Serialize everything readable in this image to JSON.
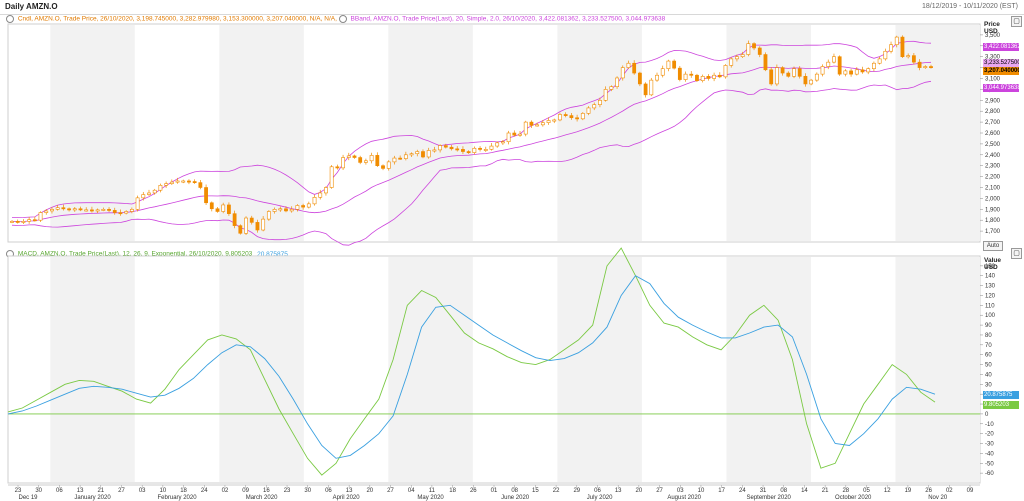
{
  "window": {
    "title": "Daily AMZN.O",
    "date_range": "18/12/2019 - 10/11/2020 (EST)"
  },
  "price_panel": {
    "legend_candle": "Cndl, AMZN.O, Trade Price, 26/10/2020, 3,198.745000, 3,282.979980, 3,153.300000, 3,207.040000, N/A, N/A,",
    "legend_bband": "BBand, AMZN.O, Trade Price(Last), 20, Simple, 2.0, 26/10/2020, 3,422.081362, 3,233.527500, 3,044.973638",
    "axis_title_1": "Price",
    "axis_title_2": "USD",
    "tag_upper": "3,422.081362",
    "tag_mid": "3,233.527500",
    "tag_close": "3,207.040000",
    "tag_lower": "3,044.973638",
    "auto": "Auto",
    "colors": {
      "candle": "#f08c00",
      "band": "#cc44dd",
      "tag_upper": "#cc44dd",
      "tag_close": "#f08c00"
    }
  },
  "macd_panel": {
    "legend": "MACD, AMZN.O, Trade Price(Last), 12, 26, 9, Exponential, 26/10/2020, 9.805203",
    "legend_signal": "20.875875",
    "axis_title_1": "Value",
    "axis_title_2": "USD",
    "tag_signal": "20.875875",
    "tag_macd": "9.805203",
    "colors": {
      "macd": "#7ac943",
      "signal": "#3aa0e0",
      "zero": "#7ac943"
    }
  },
  "x_axis": {
    "days": [
      "23",
      "30",
      "06",
      "13",
      "21",
      "27",
      "03",
      "10",
      "18",
      "24",
      "02",
      "09",
      "16",
      "23",
      "30",
      "06",
      "13",
      "20",
      "27",
      "04",
      "11",
      "18",
      "26",
      "01",
      "08",
      "15",
      "22",
      "29",
      "06",
      "13",
      "20",
      "27",
      "03",
      "10",
      "17",
      "24",
      "31",
      "08",
      "14",
      "21",
      "28",
      "05",
      "12",
      "19",
      "26",
      "02",
      "09"
    ],
    "months": [
      "Dec 19",
      "January 2020",
      "February 2020",
      "March 2020",
      "April 2020",
      "May 2020",
      "June 2020",
      "July 2020",
      "August 2020",
      "September 2020",
      "October 2020",
      "Nov 20"
    ]
  },
  "chart_data": [
    {
      "type": "candlestick",
      "title": "Daily AMZN.O",
      "ylabel": "Price USD",
      "ylim": [
        1600,
        3600
      ],
      "yticks": [
        1700,
        1800,
        1900,
        2000,
        2100,
        2200,
        2300,
        2400,
        2500,
        2600,
        2700,
        2800,
        2900,
        3000,
        3100,
        3200,
        3300,
        3400,
        3500
      ],
      "series": [
        {
          "name": "Cndl AMZN.O Trade Price",
          "values": [
            1790,
            1785,
            1790,
            1805,
            1800,
            1870,
            1885,
            1900,
            1915,
            1905,
            1900,
            1905,
            1895,
            1895,
            1890,
            1895,
            1900,
            1890,
            1870,
            1865,
            1880,
            1900,
            2005,
            2035,
            2050,
            2075,
            2120,
            2135,
            2150,
            2160,
            2160,
            2155,
            2145,
            2100,
            1960,
            1905,
            1880,
            1940,
            1860,
            1750,
            1680,
            1820,
            1780,
            1710,
            1810,
            1880,
            1900,
            1905,
            1885,
            1900,
            1935,
            1920,
            1950,
            2010,
            2050,
            2100,
            2290,
            2280,
            2375,
            2390,
            2375,
            2330,
            2345,
            2395,
            2300,
            2275,
            2335,
            2370,
            2365,
            2400,
            2410,
            2430,
            2380,
            2440,
            2445,
            2485,
            2470,
            2455,
            2450,
            2430,
            2420,
            2460,
            2450,
            2450,
            2480,
            2510,
            2520,
            2600,
            2580,
            2590,
            2700,
            2670,
            2675,
            2695,
            2715,
            2720,
            2770,
            2760,
            2740,
            2730,
            2780,
            2830,
            2860,
            2900,
            3000,
            3025,
            3105,
            3200,
            3240,
            3150,
            3050,
            2950,
            3085,
            3130,
            3190,
            3260,
            3195,
            3090,
            3140,
            3130,
            3080,
            3120,
            3100,
            3130,
            3115,
            3220,
            3280,
            3300,
            3320,
            3420,
            3380,
            3320,
            3180,
            3050,
            3200,
            3150,
            3120,
            3190,
            3120,
            3050,
            3085,
            3140,
            3210,
            3250,
            3300,
            3140,
            3170,
            3140,
            3180,
            3160,
            3190,
            3240,
            3280,
            3350,
            3410,
            3480,
            3300,
            3310,
            3250,
            3200,
            3210,
            3207
          ]
        },
        {
          "name": "BBand Upper (20, Simple, 2.0)",
          "values_last": 3422.081362
        },
        {
          "name": "BBand Middle",
          "values_last": 3233.5275
        },
        {
          "name": "BBand Lower",
          "values_last": 3044.973638
        }
      ],
      "last_bar": {
        "date": "26/10/2020",
        "open": 3198.745,
        "high": 3282.97998,
        "low": 3153.3,
        "close": 3207.04
      }
    },
    {
      "type": "line",
      "title": "MACD",
      "ylabel": "Value USD",
      "ylim": [
        -70,
        160
      ],
      "yticks": [
        -60,
        -50,
        -40,
        -30,
        -20,
        -10,
        0,
        10,
        20,
        30,
        40,
        50,
        60,
        70,
        80,
        90,
        100,
        110,
        120,
        130,
        140,
        150
      ],
      "series": [
        {
          "name": "MACD (12, 26, 9, Exponential)",
          "last": 9.805203,
          "values": [
            2,
            6,
            14,
            22,
            30,
            34,
            33,
            28,
            23,
            15,
            11,
            25,
            45,
            60,
            75,
            80,
            76,
            65,
            35,
            5,
            -20,
            -45,
            -62,
            -50,
            -25,
            -5,
            15,
            55,
            110,
            125,
            118,
            100,
            82,
            72,
            66,
            58,
            52,
            50,
            55,
            65,
            75,
            90,
            150,
            168,
            140,
            110,
            92,
            88,
            78,
            70,
            65,
            80,
            100,
            110,
            95,
            55,
            -10,
            -55,
            -50,
            -20,
            10,
            30,
            50,
            40,
            22,
            12
          ]
        },
        {
          "name": "Signal",
          "last": 20.875875,
          "values": [
            0,
            3,
            8,
            14,
            20,
            26,
            28,
            27,
            25,
            21,
            17,
            19,
            26,
            36,
            50,
            62,
            70,
            68,
            56,
            38,
            15,
            -10,
            -32,
            -45,
            -42,
            -32,
            -20,
            -2,
            40,
            88,
            108,
            110,
            100,
            90,
            80,
            72,
            64,
            57,
            54,
            56,
            62,
            72,
            88,
            120,
            140,
            132,
            112,
            98,
            90,
            83,
            77,
            77,
            82,
            88,
            90,
            78,
            40,
            -5,
            -30,
            -32,
            -20,
            -5,
            15,
            27,
            25,
            20
          ]
        }
      ]
    }
  ]
}
